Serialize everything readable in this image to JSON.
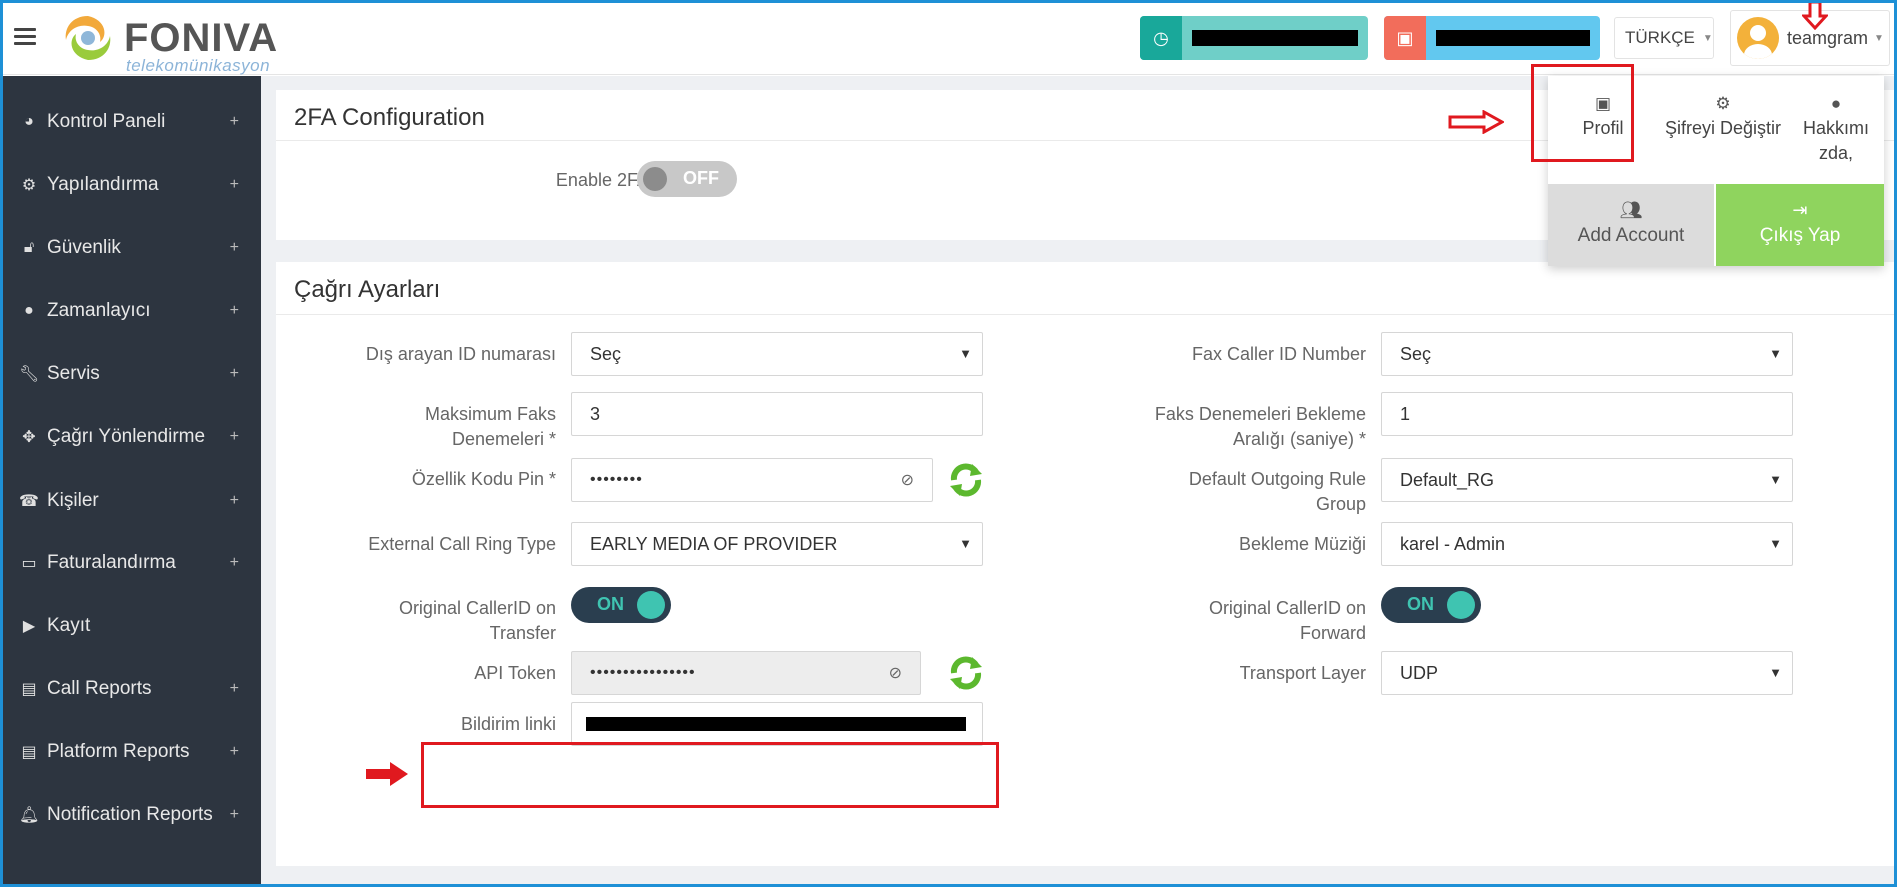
{
  "header": {
    "logo_text": "FONIVA",
    "logo_sub": "telekomünikasyon",
    "language": "TÜRKÇE",
    "username": "teamgram",
    "pill1_color": "#6fcfc8",
    "pill1_icon_color": "#19a89a",
    "pill2_color": "#62c8ef",
    "pill2_icon_color": "#f26d5b"
  },
  "sidebar": {
    "items": [
      {
        "label": "Kontrol Paneli",
        "icon": "dashboard-icon",
        "glyph": "◕",
        "expand": "+"
      },
      {
        "label": "Yapılandırma",
        "icon": "gears-icon",
        "glyph": "⚙",
        "expand": "+"
      },
      {
        "label": "Güvenlik",
        "icon": "unlock-icon",
        "glyph": "🔓︎",
        "expand": "+"
      },
      {
        "label": "Zamanlayıcı",
        "icon": "globe-icon",
        "glyph": "●",
        "expand": "+"
      },
      {
        "label": "Servis",
        "icon": "wrench-icon",
        "glyph": "🔧︎",
        "expand": "+"
      },
      {
        "label": "Çağrı Yönlendirme",
        "icon": "arrows-icon",
        "glyph": "✥",
        "expand": "+"
      },
      {
        "label": "Kişiler",
        "icon": "phone-book-icon",
        "glyph": "☎",
        "expand": "+"
      },
      {
        "label": "Faturalandırma",
        "icon": "credit-card-icon",
        "glyph": "▭",
        "expand": "+"
      },
      {
        "label": "Kayıt",
        "icon": "play-circle-icon",
        "glyph": "▶",
        "expand": ""
      },
      {
        "label": "Call Reports",
        "icon": "file-icon",
        "glyph": "▤",
        "expand": "+"
      },
      {
        "label": "Platform Reports",
        "icon": "file-icon",
        "glyph": "▤",
        "expand": "+"
      },
      {
        "label": "Notification Reports",
        "icon": "bell-icon",
        "glyph": "🔔︎",
        "expand": "+"
      }
    ]
  },
  "twofa": {
    "title": "2FA Configuration",
    "enable_label": "Enable 2FA",
    "toggle": "OFF"
  },
  "call_settings": {
    "title": "Çağrı Ayarları",
    "left": {
      "caller_id_label": "Dış arayan ID numarası",
      "caller_id_value": "Seç",
      "max_fax_label_1": "Maksimum Faks",
      "max_fax_label_2": "Denemeleri *",
      "max_fax_value": "3",
      "feature_pin_label": "Özellik Kodu Pin *",
      "feature_pin_value": "••••••••",
      "ring_type_label": "External Call Ring Type",
      "ring_type_value": "EARLY MEDIA OF PROVIDER",
      "orig_transfer_label_1": "Original CallerID on",
      "orig_transfer_label_2": "Transfer",
      "orig_transfer_toggle": "ON",
      "api_token_label": "API Token",
      "api_token_value": "••••••••••••••••",
      "notify_link_label": "Bildirim linki"
    },
    "right": {
      "fax_caller_label": "Fax Caller ID Number",
      "fax_caller_value": "Seç",
      "fax_wait_label_1": "Faks Denemeleri Bekleme",
      "fax_wait_label_2": "Aralığı (saniye) *",
      "fax_wait_value": "1",
      "outgoing_rule_label_1": "Default Outgoing Rule",
      "outgoing_rule_label_2": "Group",
      "outgoing_rule_value": "Default_RG",
      "hold_music_label": "Bekleme Müziği",
      "hold_music_value": "karel - Admin",
      "orig_forward_label_1": "Original CallerID on",
      "orig_forward_label_2": "Forward",
      "orig_forward_toggle": "ON",
      "transport_label": "Transport Layer",
      "transport_value": "UDP"
    }
  },
  "user_menu": {
    "profile": "Profil",
    "change_password": "Şifreyi Değiştir",
    "about_1": "Hakkımı",
    "about_2": "zda,",
    "add_account": "Add Account",
    "logout": "Çıkış Yap"
  }
}
